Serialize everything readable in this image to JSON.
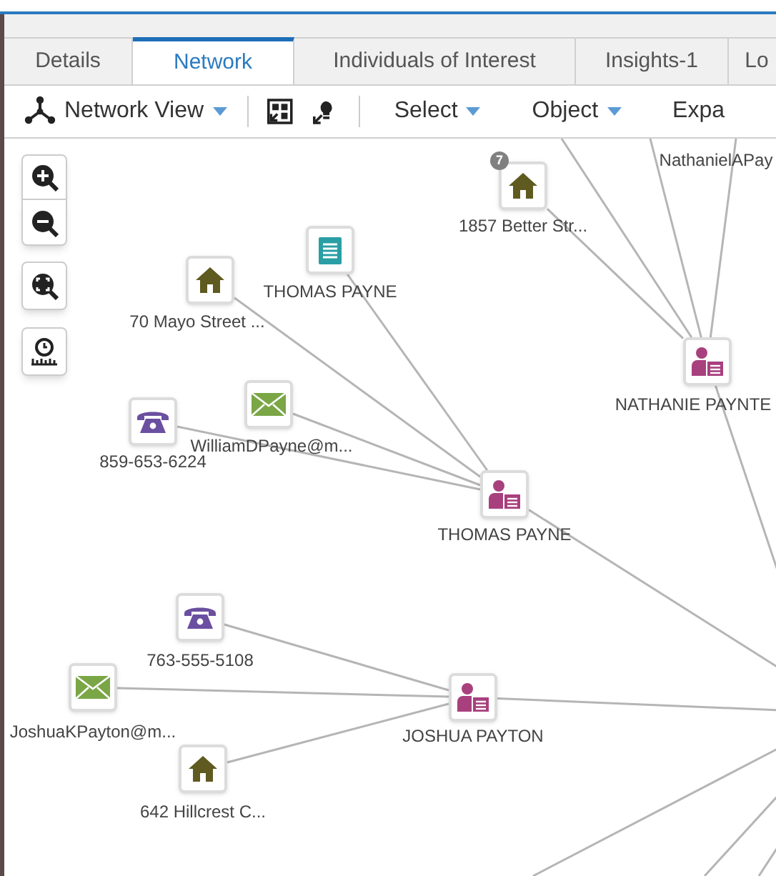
{
  "tabs": [
    {
      "label": "Details",
      "selected": false
    },
    {
      "label": "Network",
      "selected": true
    },
    {
      "label": "Individuals of Interest",
      "selected": false
    },
    {
      "label": "Insights-1",
      "selected": false
    },
    {
      "label": "Lo",
      "selected": false
    }
  ],
  "toolbar": [
    {
      "kind": "dropdown",
      "label": "Network View"
    },
    {
      "kind": "dropdown",
      "label": "Select"
    },
    {
      "kind": "dropdown",
      "label": "Object"
    },
    {
      "kind": "button",
      "label": "Expa"
    }
  ],
  "nodes": [
    {
      "kind": "house",
      "label": "1857 Better Str...",
      "badge": "7"
    },
    {
      "kind": "hidden",
      "label": "NathanielAPay"
    },
    {
      "kind": "document",
      "label": "THOMAS PAYNE"
    },
    {
      "kind": "house",
      "label": "70 Mayo Street ..."
    },
    {
      "kind": "person",
      "label": "NATHANIE PAYNTE"
    },
    {
      "kind": "email",
      "label": "WilliamDPayne@m..."
    },
    {
      "kind": "phone",
      "label": "859-653-6224"
    },
    {
      "kind": "person",
      "label": "THOMAS PAYNE"
    },
    {
      "kind": "phone",
      "label": "763-555-5108"
    },
    {
      "kind": "email",
      "label": "JoshuaKPayton@m..."
    },
    {
      "kind": "person",
      "label": "JOSHUA PAYTON"
    },
    {
      "kind": "house",
      "label": "642 Hillcrest C..."
    }
  ]
}
